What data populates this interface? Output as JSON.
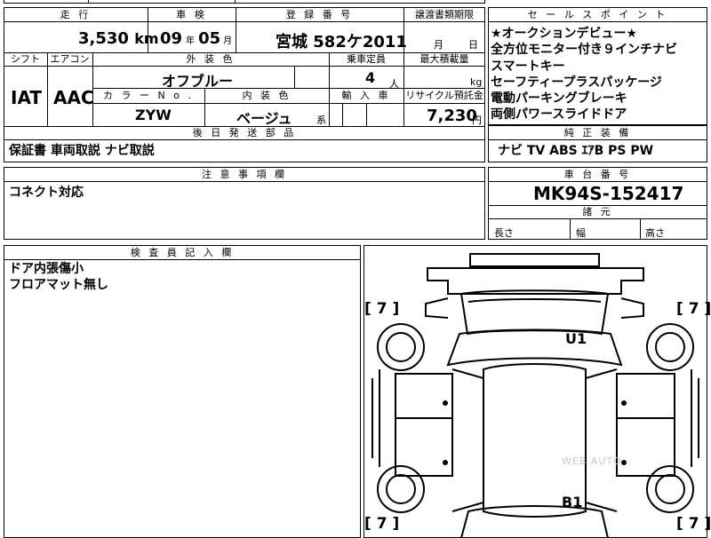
{
  "top_row": {
    "mileage": {
      "label": "走 行",
      "value": "3,530",
      "unit": "km"
    },
    "inspection": {
      "label": "車 検",
      "year": "09",
      "year_unit": "年",
      "month": "05",
      "month_unit": "月"
    },
    "registration": {
      "label": "登 録 番 号",
      "value": "宮城 582ケ2011"
    },
    "transfer_deadline": {
      "label": "譲渡書類期限",
      "month_unit": "月",
      "day_unit": "日"
    }
  },
  "second_row": {
    "shift": {
      "label": "シフト",
      "value": "IAT"
    },
    "aircon": {
      "label": "エアコン",
      "value": "AAC"
    },
    "exterior_color": {
      "label": "外 装 色",
      "value": "オフブルー"
    },
    "capacity": {
      "label": "乗車定員",
      "value": "4",
      "unit": "人"
    },
    "max_load": {
      "label": "最大積載量",
      "unit": "kg"
    },
    "color_no": {
      "label": "カ ラ ー N o .",
      "value": "ZYW"
    },
    "interior_color": {
      "label": "内 装 色",
      "value": "ベージュ",
      "suffix": "系"
    },
    "import": {
      "label": "輸 入 車"
    },
    "recycle_fee": {
      "label": "リサイクル預託金",
      "value": "7,230",
      "unit": "円"
    }
  },
  "later_parts": {
    "label": "後 日 発 送 部 品",
    "value": "保証書 車両取説 ナビ取説"
  },
  "notes": {
    "label": "注 意 事 項 欄",
    "value": "コネクト対応"
  },
  "sales_points": {
    "label": "セ ー ル ス ポ イ ン ト",
    "items": [
      "★オークションデビュー★",
      "全方位モニター付き９インチナビ",
      "スマートキー",
      "セーフティープラスパッケージ",
      "電動パーキングブレーキ",
      "両側パワースライドドア"
    ]
  },
  "genuine_equipment": {
    "label": "純 正 装 備",
    "value": "ナビ TV ABS ｴｱB PS PW"
  },
  "chassis_number": {
    "label": "車 台 番 号",
    "value": "MK94S-152417"
  },
  "dimensions": {
    "label": "諸 元",
    "length": "長さ",
    "width": "幅",
    "height": "高さ"
  },
  "inspector_notes": {
    "label": "検 査 員 記 入 欄",
    "lines": [
      "ドア内張傷小",
      "フロアマット無し"
    ]
  },
  "diagram": {
    "tl_count": "7",
    "tr_count": "7",
    "bl_count": "7",
    "br_count": "7",
    "mark_u1": "U1",
    "mark_b1": "B1",
    "watermark": "WEB AUTO"
  }
}
